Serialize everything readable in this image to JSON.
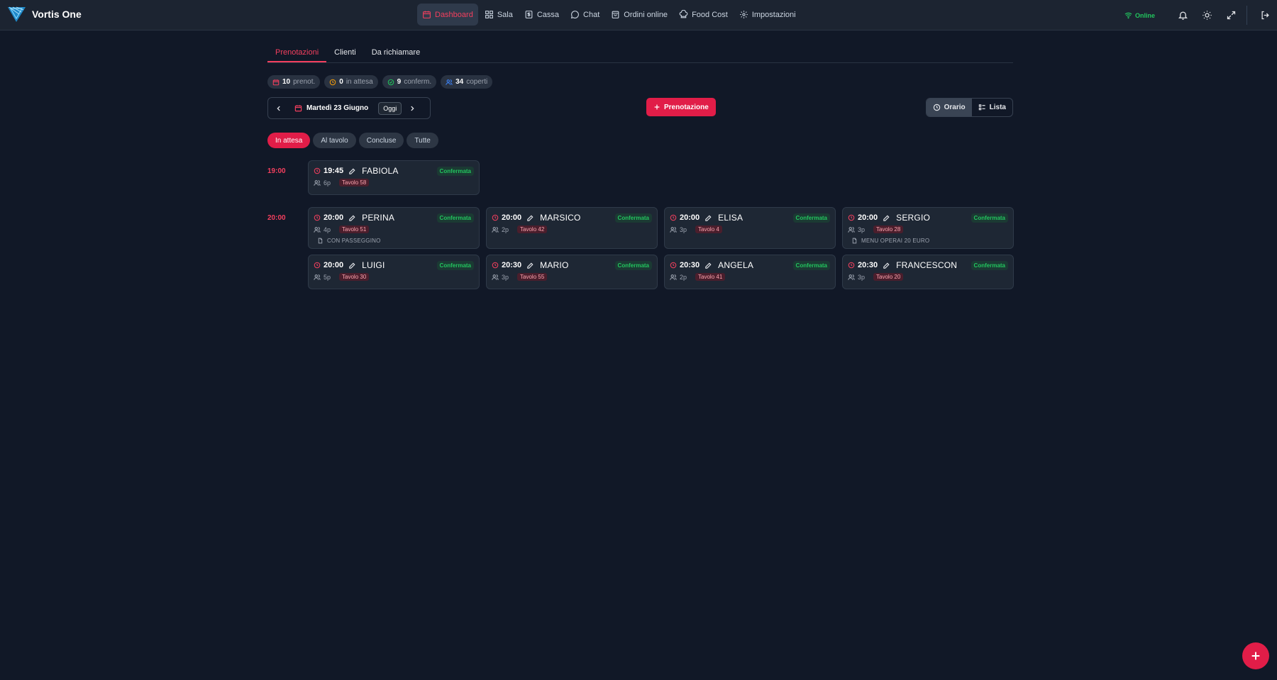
{
  "app": {
    "name": "Vortis One"
  },
  "nav": [
    {
      "label": "Dashboard",
      "icon": "calendar-icon",
      "active": true
    },
    {
      "label": "Sala",
      "icon": "grid-icon"
    },
    {
      "label": "Cassa",
      "icon": "dollar-icon"
    },
    {
      "label": "Chat",
      "icon": "chat-icon"
    },
    {
      "label": "Ordini online",
      "icon": "bag-icon"
    },
    {
      "label": "Food Cost",
      "icon": "chef-hat-icon"
    },
    {
      "label": "Impostazioni",
      "icon": "gear-icon"
    }
  ],
  "status": {
    "online_label": "Online"
  },
  "tabs": [
    {
      "label": "Prenotazioni",
      "active": true
    },
    {
      "label": "Clienti"
    },
    {
      "label": "Da richiamare"
    }
  ],
  "stats": [
    {
      "value": "10",
      "label": "prenot.",
      "icon": "calendar-icon",
      "color": "#f43f5e"
    },
    {
      "value": "0",
      "label": "in attesa",
      "icon": "clock-icon",
      "color": "#f59e0b"
    },
    {
      "value": "9",
      "label": "conferm.",
      "icon": "check-circle-icon",
      "color": "#22c55e"
    },
    {
      "value": "34",
      "label": "coperti",
      "icon": "users-icon",
      "color": "#3b82f6"
    }
  ],
  "date": {
    "label": "Martedì 23 Giugno",
    "today_label": "Oggi"
  },
  "add_button": {
    "label": "Prenotazione"
  },
  "views": [
    {
      "label": "Orario",
      "icon": "clock-icon",
      "active": true
    },
    {
      "label": "Lista",
      "icon": "list-icon"
    }
  ],
  "filters": [
    {
      "label": "In attesa",
      "active": true
    },
    {
      "label": "Al tavolo"
    },
    {
      "label": "Concluse"
    },
    {
      "label": "Tutte"
    }
  ],
  "slots": [
    {
      "time": "19:00",
      "bookings": [
        {
          "time": "19:45",
          "name": "FABIOLA",
          "status": "Confermata",
          "people": "6p",
          "table": "Tavolo 58",
          "note": ""
        }
      ]
    },
    {
      "time": "20:00",
      "bookings": [
        {
          "time": "20:00",
          "name": "PERINA",
          "status": "Confermata",
          "people": "4p",
          "table": "Tavolo 51",
          "note": "CON PASSEGGINO"
        },
        {
          "time": "20:00",
          "name": "MARSICO",
          "status": "Confermata",
          "people": "2p",
          "table": "Tavolo 42",
          "note": ""
        },
        {
          "time": "20:00",
          "name": "ELISA",
          "status": "Confermata",
          "people": "3p",
          "table": "Tavolo 4",
          "note": ""
        },
        {
          "time": "20:00",
          "name": "SERGIO",
          "status": "Confermata",
          "people": "3p",
          "table": "Tavolo 28",
          "note": "MENU OPERAI 20 EURO"
        },
        {
          "time": "20:00",
          "name": "LUIGI",
          "status": "Confermata",
          "people": "5p",
          "table": "Tavolo 30",
          "note": ""
        },
        {
          "time": "20:30",
          "name": "MARIO",
          "status": "Confermata",
          "people": "3p",
          "table": "Tavolo 55",
          "note": ""
        },
        {
          "time": "20:30",
          "name": "ANGELA",
          "status": "Confermata",
          "people": "2p",
          "table": "Tavolo 41",
          "note": ""
        },
        {
          "time": "20:30",
          "name": "FRANCESCON",
          "status": "Confermata",
          "people": "3p",
          "table": "Tavolo 20",
          "note": ""
        }
      ]
    }
  ]
}
